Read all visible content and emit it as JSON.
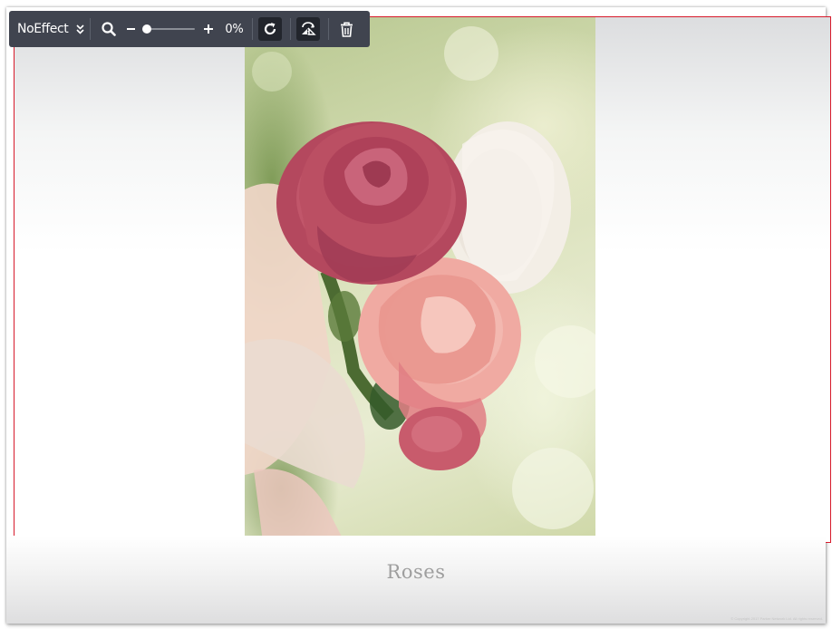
{
  "toolbar": {
    "effect_label": "NoEffect",
    "zoom_percent": "0%",
    "zoom_level": 0,
    "icons": {
      "effect_dropdown": "double-chevron-down-icon",
      "search": "search-icon",
      "zoom_out": "minus-icon",
      "zoom_in": "plus-icon",
      "rotate": "rotate-icon",
      "flip": "flip-horizontal-icon",
      "delete": "trash-icon"
    }
  },
  "photo": {
    "subject": "pink and red roses bouquet"
  },
  "caption": {
    "title": "Roses",
    "copyright": "© Copyright 2017 Parker Network Ltd. All rights reserved."
  },
  "colors": {
    "frame_border": "#d71a2b",
    "toolbar_bg": "#40444f",
    "caption_text": "#9e9e9e"
  }
}
